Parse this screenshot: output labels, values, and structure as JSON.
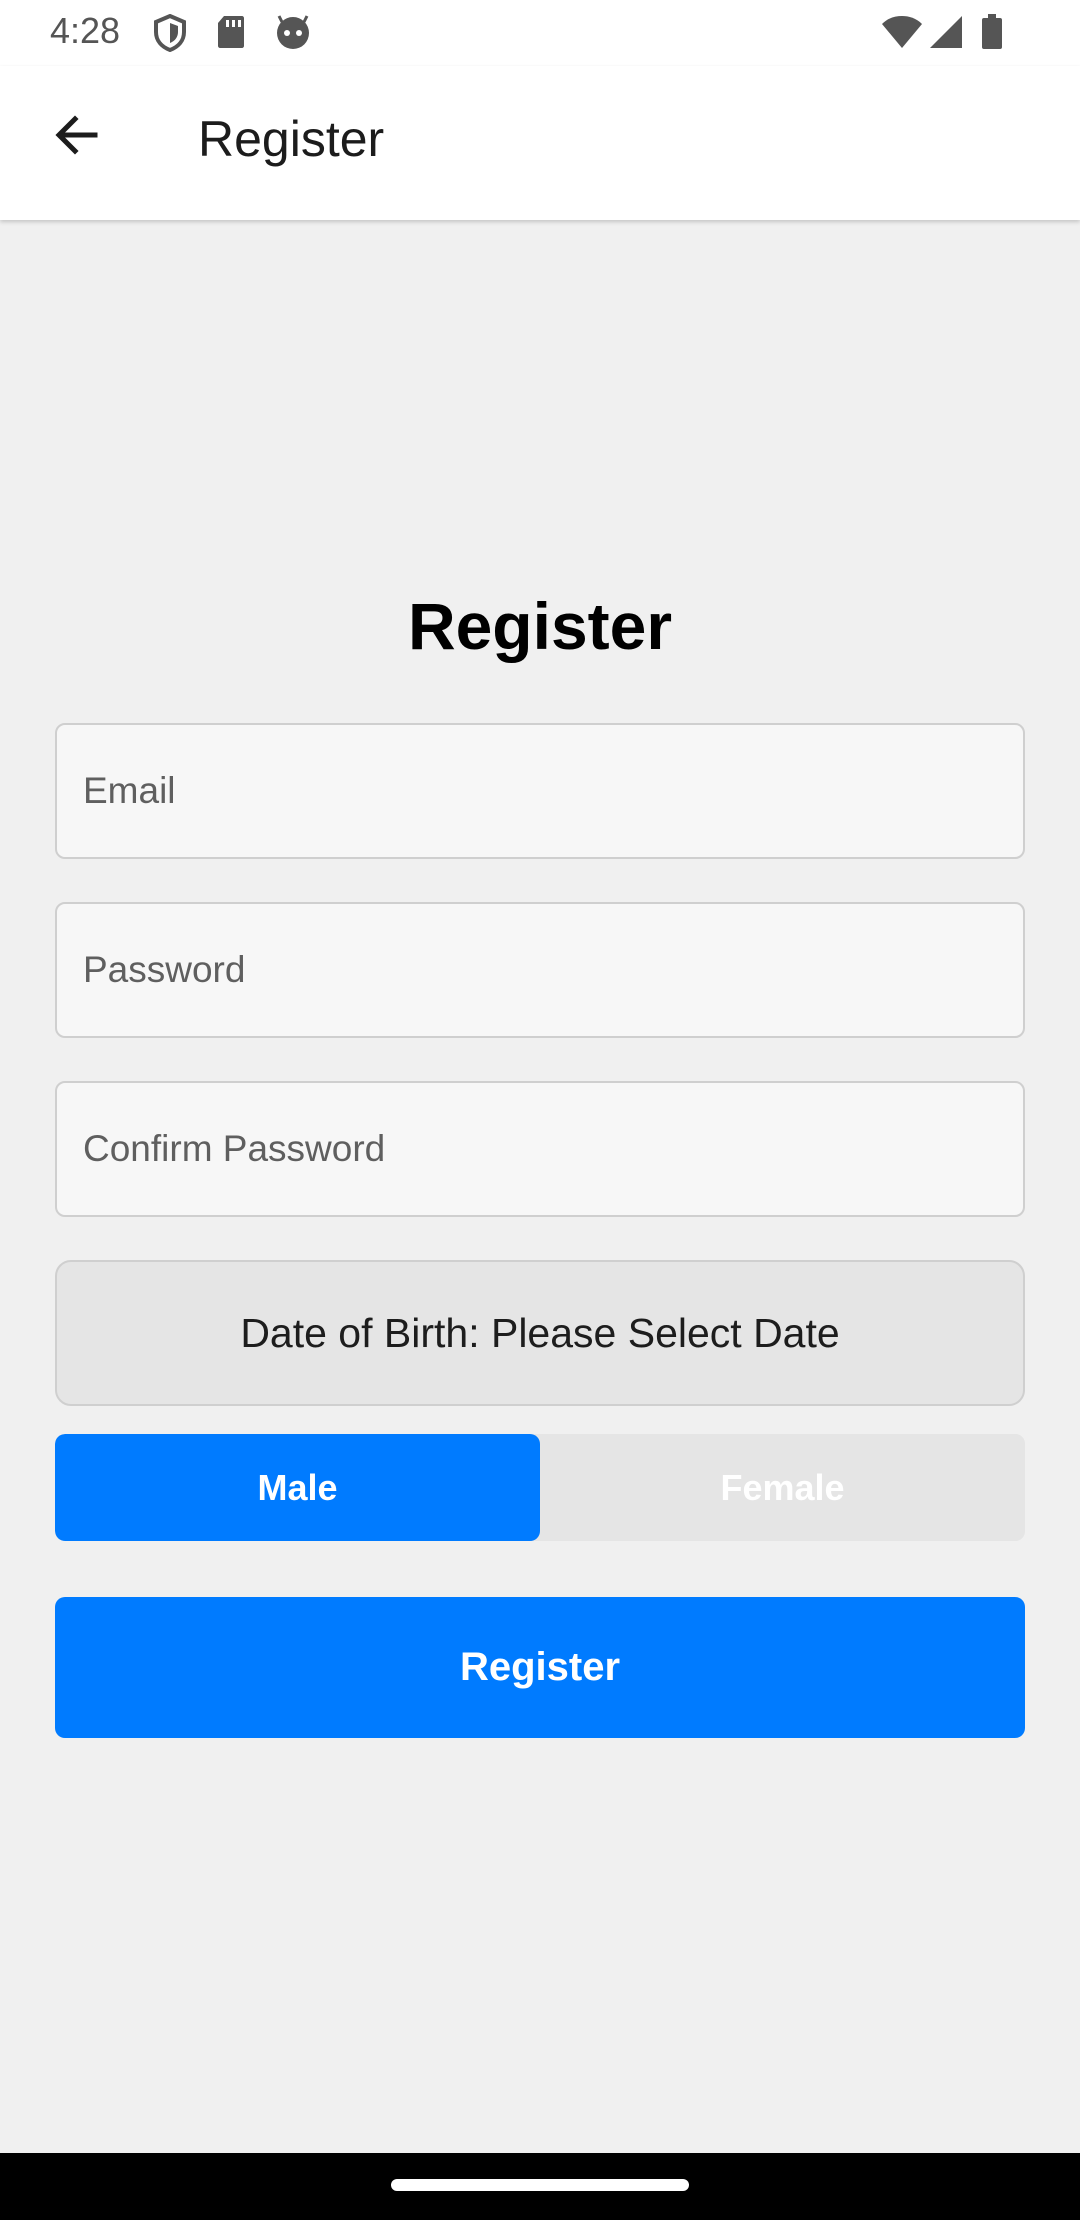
{
  "status_bar": {
    "time": "4:28",
    "left_icons": [
      "shield-icon",
      "sd-card-icon",
      "robot-face-icon"
    ],
    "right_icons": [
      "wifi-icon",
      "cellular-signal-icon",
      "battery-icon"
    ]
  },
  "app_bar": {
    "back_icon": "arrow-back-icon",
    "title": "Register"
  },
  "form": {
    "heading": "Register",
    "email_placeholder": "Email",
    "password_placeholder": "Password",
    "confirm_password_placeholder": "Confirm Password",
    "dob_label": "Date of Birth: Please Select Date",
    "gender": {
      "options": [
        "Male",
        "Female"
      ],
      "selected": "Male"
    },
    "submit_label": "Register"
  },
  "colors": {
    "accent": "#007bff",
    "background": "#f0f0f0",
    "field_background": "#f7f7f7",
    "field_border": "#cfcfcf",
    "toggle_inactive": "#e5e5e5"
  }
}
